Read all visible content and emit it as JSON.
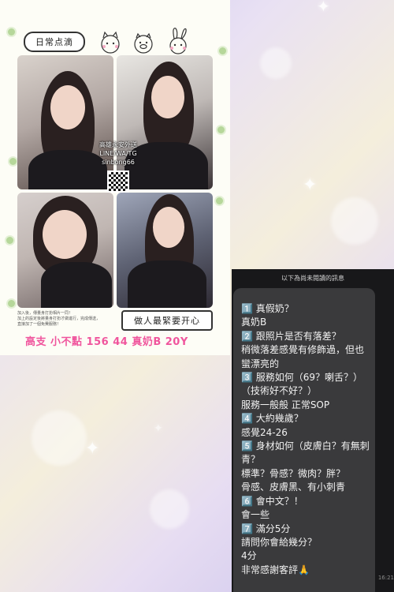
{
  "poster": {
    "title": "日常点滴",
    "contact_lines": [
      "高雄永安外送",
      "LINE/WA/TG",
      "sinbong66"
    ],
    "note_lines": [
      "加入後，傳量身打扮相片一同！",
      "加上的設定後將量身打扮才做進行，完成傳送，",
      "直接加了一個免費服務！"
    ],
    "slogan": "做人最緊要开心",
    "highlight": "高支 小不點 156 44 真奶B 20Y"
  },
  "chat": {
    "header": "以下為尚未閱讀的訊息",
    "lines": [
      "1️⃣ 真假奶？",
      "真奶B",
      "2️⃣ 跟照片是否有落差？",
      "稍微落差感覺有修飾過，但也",
      "蠻漂亮的",
      "3️⃣ 服務如何（69？喇舌？）",
      "（技術好不好？）",
      "服務一般般 正常SOP",
      "4️⃣ 大約幾歲？",
      "感覺24-26",
      "5️⃣ 身材如何（皮膚白？有無刺",
      "青？",
      "標準？骨感？微肉？胖？",
      "骨感、皮膚黑、有小刺青",
      "6️⃣ 會中文？！",
      "會一些",
      "7️⃣ 滿分5分",
      "請問你會給幾分？",
      "4分",
      "非常感謝客評🙏"
    ],
    "time": "16:21"
  },
  "icons": {
    "sparkle": "sparkle-star",
    "animals": "cat-pig-rabbit-doodle"
  }
}
